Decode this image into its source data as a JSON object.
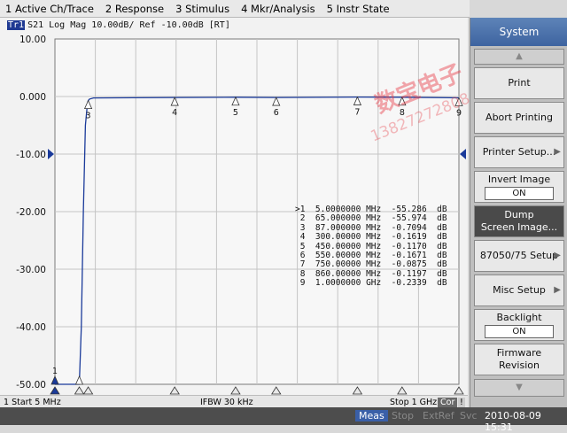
{
  "menubar": {
    "items": [
      "1 Active Ch/Trace",
      "2 Response",
      "3 Stimulus",
      "4 Mkr/Analysis",
      "5 Instr State"
    ]
  },
  "trace": {
    "badge": "Tr1",
    "header": "S21 Log Mag 10.00dB/ Ref -10.00dB [RT]"
  },
  "chart_data": {
    "type": "line",
    "title": "",
    "xlabel": "",
    "ylabel": "",
    "xlim_mhz": [
      5,
      1000
    ],
    "ylim": [
      -50,
      10
    ],
    "yticks": [
      "10.00",
      "0.000",
      "-10.00",
      "-20.00",
      "-30.00",
      "-40.00",
      "-50.00"
    ],
    "grid": true,
    "reference_level": -10,
    "series": [
      {
        "x_mhz": [
          5,
          50,
          62,
          65,
          70,
          75,
          80,
          85,
          87,
          90,
          100,
          300,
          450,
          550,
          750,
          860,
          1000
        ],
        "y_db": [
          -55.286,
          -55.5,
          -55.8,
          -55.974,
          -40,
          -20,
          -5,
          -1.2,
          -0.7094,
          -0.45,
          -0.25,
          -0.1619,
          -0.117,
          -0.1671,
          -0.0875,
          -0.1197,
          -0.2339
        ]
      }
    ],
    "markers": [
      {
        "id": "1",
        "active": true,
        "freq": "5.0000000",
        "unit": "MHz",
        "value": "-55.286",
        "x_mhz": 5,
        "y_db": -55.286
      },
      {
        "id": "2",
        "active": false,
        "freq": "65.000000",
        "unit": "MHz",
        "value": "-55.974",
        "x_mhz": 65,
        "y_db": -55.974
      },
      {
        "id": "3",
        "active": false,
        "freq": "87.000000",
        "unit": "MHz",
        "value": "-0.7094",
        "x_mhz": 87,
        "y_db": -0.7094
      },
      {
        "id": "4",
        "active": false,
        "freq": "300.00000",
        "unit": "MHz",
        "value": "-0.1619",
        "x_mhz": 300,
        "y_db": -0.1619
      },
      {
        "id": "5",
        "active": false,
        "freq": "450.00000",
        "unit": "MHz",
        "value": "-0.1170",
        "x_mhz": 450,
        "y_db": -0.117
      },
      {
        "id": "6",
        "active": false,
        "freq": "550.00000",
        "unit": "MHz",
        "value": "-0.1671",
        "x_mhz": 550,
        "y_db": -0.1671
      },
      {
        "id": "7",
        "active": false,
        "freq": "750.00000",
        "unit": "MHz",
        "value": "-0.0875",
        "x_mhz": 750,
        "y_db": -0.0875
      },
      {
        "id": "8",
        "active": false,
        "freq": "860.00000",
        "unit": "MHz",
        "value": "-0.1197",
        "x_mhz": 860,
        "y_db": -0.1197
      },
      {
        "id": "9",
        "active": false,
        "freq": "1.0000000",
        "unit": "GHz",
        "value": "-0.2339",
        "x_mhz": 1000,
        "y_db": -0.2339
      }
    ],
    "unit_db": "dB",
    "trace_color": "#1a3a9a"
  },
  "status": {
    "start": "1  Start 5 MHz",
    "ifbw": "IFBW 30 kHz",
    "stop": "Stop 1 GHz",
    "cor": "Cor",
    "excl": "!"
  },
  "sidebar": {
    "title": "System",
    "buttons": [
      {
        "label": "Print"
      },
      {
        "label": "Abort Printing"
      },
      {
        "label": "Printer Setup..."
      },
      {
        "label": "Invert Image",
        "state": "ON"
      },
      {
        "label": "Dump",
        "label2": "Screen Image..."
      },
      {
        "label": "87050/75 Setup"
      },
      {
        "label": "Misc Setup"
      },
      {
        "label": "Backlight",
        "state": "ON"
      },
      {
        "label": "Firmware",
        "label2": "Revision"
      }
    ]
  },
  "taskbar": {
    "meas": "Meas",
    "stop": "Stop",
    "extref": "ExtRef",
    "svc": "Svc",
    "datetime": "2010-08-09 15:31"
  },
  "watermark": {
    "line1": "数宝电子",
    "line2": "13827272808"
  }
}
